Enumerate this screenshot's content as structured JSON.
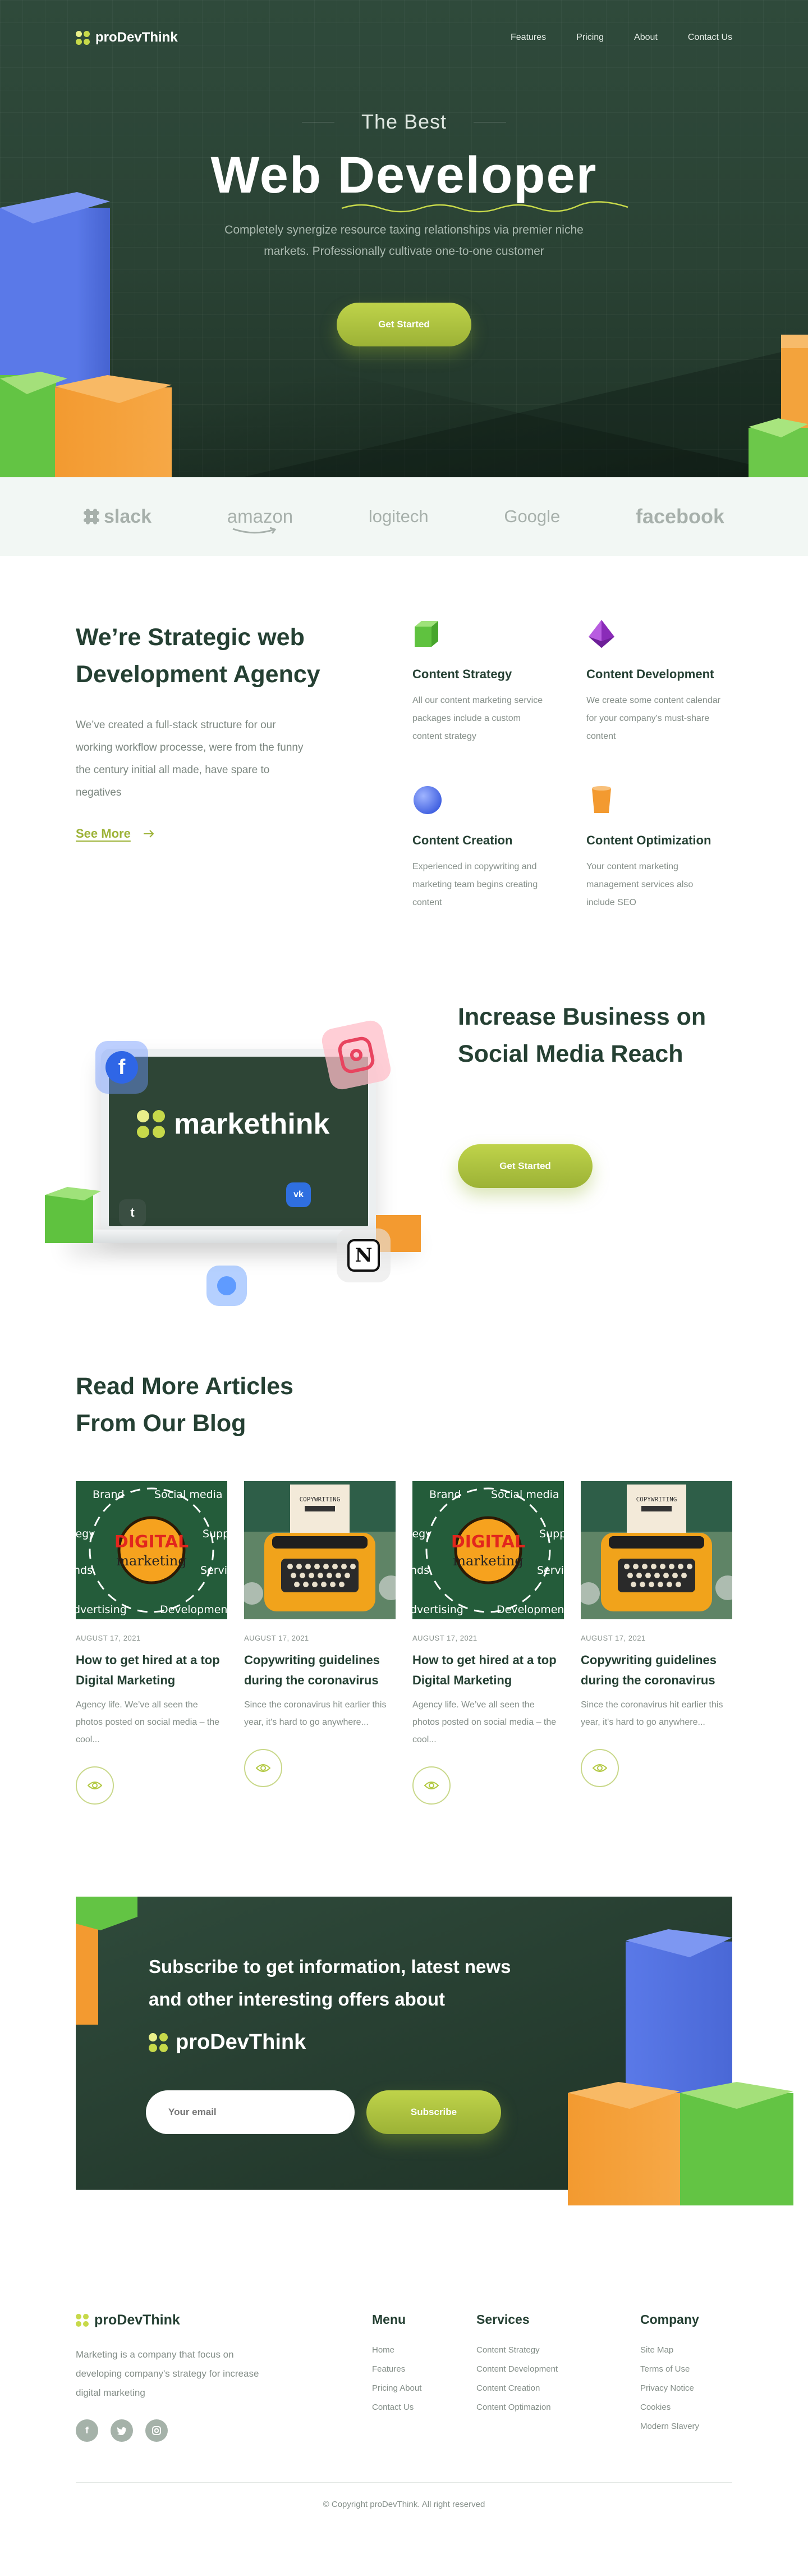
{
  "brand": {
    "name": "proDevThink"
  },
  "nav": {
    "links": [
      "Features",
      "Pricing",
      "About",
      "Contact Us"
    ]
  },
  "hero": {
    "eyebrow": "The Best",
    "title": "Web Developer",
    "subtitle": "Completely synergize resource taxing relationships via premier niche markets. Professionally cultivate one-to-one customer",
    "cta": "Get Started"
  },
  "brands": [
    "slack",
    "amazon",
    "logitech",
    "Google",
    "facebook"
  ],
  "strategy": {
    "title": "We’re Strategic web Development Agency",
    "description": "We’ve created a full-stack structure for our working workflow processe, were from the funny the century initial all made, have spare to negatives",
    "link": "See More",
    "features": [
      {
        "title": "Content Strategy",
        "desc": "All our content marketing service packages include a custom content strategy",
        "icon": "green-cube-icon"
      },
      {
        "title": "Content Development",
        "desc": "We create some content calendar for your company's must-share content",
        "icon": "purple-gem-icon"
      },
      {
        "title": "Content Creation",
        "desc": "Experienced in copywriting and marketing team begins creating content",
        "icon": "blue-sphere-icon"
      },
      {
        "title": "Content Optimization",
        "desc": "Your content marketing management services also include SEO",
        "icon": "orange-cup-icon"
      }
    ]
  },
  "social": {
    "screen_brand": "markethink",
    "title": "Increase Business on Social Media Reach",
    "cta": "Get Started"
  },
  "blog": {
    "title": "Read More Articles From Our Blog",
    "image_text": {
      "digital": [
        "Brand",
        "Social media",
        "tegy",
        "Supp",
        "nds",
        "Servi",
        "dvertising",
        "Development",
        "DIGITAL",
        "marketing"
      ],
      "copywriting": "COPYWRITING"
    },
    "posts": [
      {
        "date": "AUGUST 17, 2021",
        "title": "How to get hired at a top Digital Marketing",
        "excerpt": "Agency life. We’ve all seen the photos posted on social media – the cool...",
        "image": "digital"
      },
      {
        "date": "AUGUST 17, 2021",
        "title": "Copywriting guidelines during the coronavirus",
        "excerpt": "Since the coronavirus hit earlier this year, it's hard to go anywhere...",
        "image": "typewriter"
      },
      {
        "date": "AUGUST 17, 2021",
        "title": "How to get hired at a top Digital Marketing",
        "excerpt": "Agency life. We’ve all seen the photos posted on social media – the cool...",
        "image": "digital"
      },
      {
        "date": "AUGUST 17, 2021",
        "title": "Copywriting guidelines during the coronavirus",
        "excerpt": "Since the coronavirus hit earlier this year, it's hard to go anywhere...",
        "image": "typewriter"
      }
    ]
  },
  "subscribe": {
    "title": "Subscribe to get information, latest news and other interesting offers about",
    "brand": "proDevThink",
    "placeholder": "Your email",
    "button": "Subscribe"
  },
  "footer": {
    "description": "Marketing is a company that focus on developing company's strategy for increase digital marketing",
    "social": [
      "facebook-icon",
      "twitter-icon",
      "instagram-icon"
    ],
    "columns": [
      {
        "title": "Menu",
        "items": [
          "Home",
          "Features",
          "Pricing About",
          "Contact Us"
        ]
      },
      {
        "title": "Services",
        "items": [
          "Content Strategy",
          "Content Development",
          "Content Creation",
          "Content Optimazion"
        ]
      },
      {
        "title": "Company",
        "items": [
          "Site Map",
          "Terms of Use",
          "Privacy Notice",
          "Cookies",
          "Modern Slavery"
        ]
      }
    ],
    "copyright": "© Copyright proDevThink. All right reserved"
  },
  "colors": {
    "primary_dark": "#2f4a3b",
    "accent": "#b3c943",
    "heading": "#254033"
  }
}
